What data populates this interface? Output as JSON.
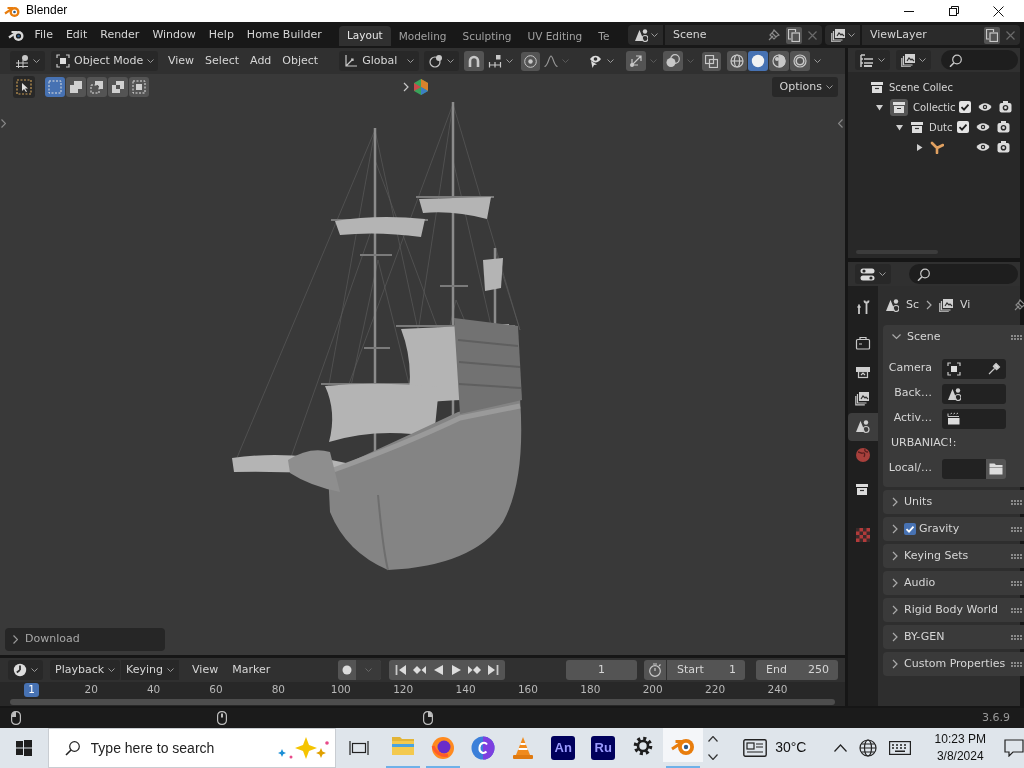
{
  "window": {
    "title": "Blender"
  },
  "top_bar": {
    "menus": [
      "File",
      "Edit",
      "Render",
      "Window",
      "Help",
      "Home Builder"
    ],
    "workspace_tabs": [
      {
        "label": "Layout",
        "selected": true
      },
      {
        "label": "Modeling",
        "selected": false
      },
      {
        "label": "Sculpting",
        "selected": false
      },
      {
        "label": "UV Editing",
        "selected": false
      },
      {
        "label": "Te",
        "selected": false
      }
    ],
    "scene": "Scene",
    "view_layer": "ViewLayer"
  },
  "viewport": {
    "header": {
      "mode": "Object Mode",
      "menus": [
        "View",
        "Select",
        "Add",
        "Object"
      ],
      "orientation": "Global",
      "shading": [
        {
          "kind": "wireframe",
          "selected": false
        },
        {
          "kind": "solid",
          "selected": true
        },
        {
          "kind": "material",
          "selected": false
        },
        {
          "kind": "rendered",
          "selected": false
        }
      ]
    },
    "toolbar": {
      "select_modes": [
        {
          "kind": "set",
          "selected": true
        },
        {
          "kind": "extend",
          "selected": false
        },
        {
          "kind": "subtract",
          "selected": false
        },
        {
          "kind": "invert",
          "selected": false
        },
        {
          "kind": "intersect",
          "selected": false
        }
      ],
      "options": "Options"
    },
    "last_operator": {
      "title": "Download",
      "expanded": false
    }
  },
  "timeline": {
    "menus": [
      {
        "label": "Playback",
        "kind": "dropdown"
      },
      {
        "label": "Keying",
        "kind": "dropdown"
      },
      {
        "label": "View",
        "kind": "menu"
      },
      {
        "label": "Marker",
        "kind": "menu"
      }
    ],
    "current_frame": "1",
    "start": {
      "label": "Start",
      "value": "1"
    },
    "end": {
      "label": "End",
      "value": "250"
    },
    "ruler": {
      "current": "1",
      "ticks": [
        "20",
        "40",
        "60",
        "80",
        "100",
        "120",
        "140",
        "160",
        "180",
        "200",
        "220",
        "240"
      ]
    }
  },
  "status_bar": {
    "version": "3.6.9"
  },
  "outliner": {
    "tree": [
      {
        "label": "Scene Collec",
        "kind": "scene_collection",
        "active": false,
        "children": [
          {
            "label": "Collectic",
            "kind": "collection",
            "expanded": true,
            "checked": true,
            "active": true,
            "children": [
              {
                "label": "Dutc",
                "kind": "collection",
                "expanded": true,
                "checked": true,
                "active": false,
                "children": [
                  {
                    "kind": "armature",
                    "expanded": false,
                    "active": false
                  }
                ]
              }
            ]
          }
        ]
      }
    ]
  },
  "properties": {
    "tabs": [
      {
        "kind": "tool",
        "selected": false
      },
      {
        "kind": "render",
        "selected": false
      },
      {
        "kind": "output",
        "selected": false
      },
      {
        "kind": "view_layer",
        "selected": false
      },
      {
        "kind": "scene",
        "selected": true
      },
      {
        "kind": "world",
        "selected": false
      },
      {
        "kind": "collection",
        "selected": false
      },
      {
        "kind": "texture",
        "selected": false
      }
    ],
    "breadcrumb": [
      "Sc",
      "Vi"
    ],
    "panels": [
      {
        "title": "Scene",
        "expanded": true,
        "fields": [
          {
            "label": "Camera",
            "kind": "object"
          },
          {
            "label": "Back…",
            "kind": "scene"
          },
          {
            "label": "Activ…",
            "kind": "clip"
          },
          {
            "label": "URBANIAC!:",
            "kind": "heading"
          },
          {
            "label": "Local/…",
            "kind": "path"
          }
        ]
      },
      {
        "title": "Units",
        "expanded": false
      },
      {
        "title": "Gravity",
        "expanded": false,
        "checked": true
      },
      {
        "title": "Keying Sets",
        "expanded": false
      },
      {
        "title": "Audio",
        "expanded": false
      },
      {
        "title": "Rigid Body World",
        "expanded": false
      },
      {
        "title": "BY-GEN",
        "expanded": false
      },
      {
        "title": "Custom Properties",
        "expanded": false
      }
    ]
  },
  "taskbar": {
    "search": {
      "placeholder": "Type here to search"
    },
    "apps": [
      {
        "kind": "folder",
        "running": true,
        "active": false
      },
      {
        "kind": "browser",
        "running": true,
        "active": false
      },
      {
        "kind": "circle",
        "running": false,
        "active": false
      },
      {
        "kind": "cone",
        "running": false,
        "active": false
      },
      {
        "kind": "tile",
        "label": "An",
        "running": false,
        "active": false
      },
      {
        "kind": "tile",
        "label": "Ru",
        "running": false,
        "active": false
      },
      {
        "kind": "gear",
        "running": false,
        "active": false
      },
      {
        "kind": "blender",
        "running": true,
        "active": true
      }
    ],
    "weather": "30°C",
    "clock": {
      "time": "10:23 PM",
      "date": "3/8/2024"
    }
  }
}
